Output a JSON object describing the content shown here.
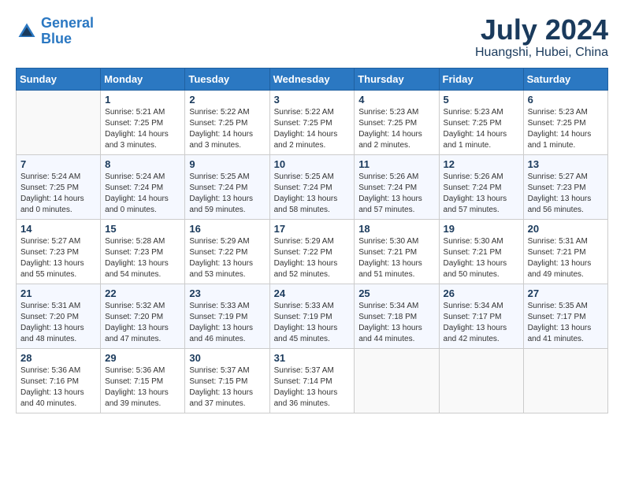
{
  "header": {
    "logo_line1": "General",
    "logo_line2": "Blue",
    "month": "July 2024",
    "location": "Huangshi, Hubei, China"
  },
  "weekdays": [
    "Sunday",
    "Monday",
    "Tuesday",
    "Wednesday",
    "Thursday",
    "Friday",
    "Saturday"
  ],
  "weeks": [
    [
      {
        "day": "",
        "info": ""
      },
      {
        "day": "1",
        "info": "Sunrise: 5:21 AM\nSunset: 7:25 PM\nDaylight: 14 hours\nand 3 minutes."
      },
      {
        "day": "2",
        "info": "Sunrise: 5:22 AM\nSunset: 7:25 PM\nDaylight: 14 hours\nand 3 minutes."
      },
      {
        "day": "3",
        "info": "Sunrise: 5:22 AM\nSunset: 7:25 PM\nDaylight: 14 hours\nand 2 minutes."
      },
      {
        "day": "4",
        "info": "Sunrise: 5:23 AM\nSunset: 7:25 PM\nDaylight: 14 hours\nand 2 minutes."
      },
      {
        "day": "5",
        "info": "Sunrise: 5:23 AM\nSunset: 7:25 PM\nDaylight: 14 hours\nand 1 minute."
      },
      {
        "day": "6",
        "info": "Sunrise: 5:23 AM\nSunset: 7:25 PM\nDaylight: 14 hours\nand 1 minute."
      }
    ],
    [
      {
        "day": "7",
        "info": "Sunrise: 5:24 AM\nSunset: 7:25 PM\nDaylight: 14 hours\nand 0 minutes."
      },
      {
        "day": "8",
        "info": "Sunrise: 5:24 AM\nSunset: 7:24 PM\nDaylight: 14 hours\nand 0 minutes."
      },
      {
        "day": "9",
        "info": "Sunrise: 5:25 AM\nSunset: 7:24 PM\nDaylight: 13 hours\nand 59 minutes."
      },
      {
        "day": "10",
        "info": "Sunrise: 5:25 AM\nSunset: 7:24 PM\nDaylight: 13 hours\nand 58 minutes."
      },
      {
        "day": "11",
        "info": "Sunrise: 5:26 AM\nSunset: 7:24 PM\nDaylight: 13 hours\nand 57 minutes."
      },
      {
        "day": "12",
        "info": "Sunrise: 5:26 AM\nSunset: 7:24 PM\nDaylight: 13 hours\nand 57 minutes."
      },
      {
        "day": "13",
        "info": "Sunrise: 5:27 AM\nSunset: 7:23 PM\nDaylight: 13 hours\nand 56 minutes."
      }
    ],
    [
      {
        "day": "14",
        "info": "Sunrise: 5:27 AM\nSunset: 7:23 PM\nDaylight: 13 hours\nand 55 minutes."
      },
      {
        "day": "15",
        "info": "Sunrise: 5:28 AM\nSunset: 7:23 PM\nDaylight: 13 hours\nand 54 minutes."
      },
      {
        "day": "16",
        "info": "Sunrise: 5:29 AM\nSunset: 7:22 PM\nDaylight: 13 hours\nand 53 minutes."
      },
      {
        "day": "17",
        "info": "Sunrise: 5:29 AM\nSunset: 7:22 PM\nDaylight: 13 hours\nand 52 minutes."
      },
      {
        "day": "18",
        "info": "Sunrise: 5:30 AM\nSunset: 7:21 PM\nDaylight: 13 hours\nand 51 minutes."
      },
      {
        "day": "19",
        "info": "Sunrise: 5:30 AM\nSunset: 7:21 PM\nDaylight: 13 hours\nand 50 minutes."
      },
      {
        "day": "20",
        "info": "Sunrise: 5:31 AM\nSunset: 7:21 PM\nDaylight: 13 hours\nand 49 minutes."
      }
    ],
    [
      {
        "day": "21",
        "info": "Sunrise: 5:31 AM\nSunset: 7:20 PM\nDaylight: 13 hours\nand 48 minutes."
      },
      {
        "day": "22",
        "info": "Sunrise: 5:32 AM\nSunset: 7:20 PM\nDaylight: 13 hours\nand 47 minutes."
      },
      {
        "day": "23",
        "info": "Sunrise: 5:33 AM\nSunset: 7:19 PM\nDaylight: 13 hours\nand 46 minutes."
      },
      {
        "day": "24",
        "info": "Sunrise: 5:33 AM\nSunset: 7:19 PM\nDaylight: 13 hours\nand 45 minutes."
      },
      {
        "day": "25",
        "info": "Sunrise: 5:34 AM\nSunset: 7:18 PM\nDaylight: 13 hours\nand 44 minutes."
      },
      {
        "day": "26",
        "info": "Sunrise: 5:34 AM\nSunset: 7:17 PM\nDaylight: 13 hours\nand 42 minutes."
      },
      {
        "day": "27",
        "info": "Sunrise: 5:35 AM\nSunset: 7:17 PM\nDaylight: 13 hours\nand 41 minutes."
      }
    ],
    [
      {
        "day": "28",
        "info": "Sunrise: 5:36 AM\nSunset: 7:16 PM\nDaylight: 13 hours\nand 40 minutes."
      },
      {
        "day": "29",
        "info": "Sunrise: 5:36 AM\nSunset: 7:15 PM\nDaylight: 13 hours\nand 39 minutes."
      },
      {
        "day": "30",
        "info": "Sunrise: 5:37 AM\nSunset: 7:15 PM\nDaylight: 13 hours\nand 37 minutes."
      },
      {
        "day": "31",
        "info": "Sunrise: 5:37 AM\nSunset: 7:14 PM\nDaylight: 13 hours\nand 36 minutes."
      },
      {
        "day": "",
        "info": ""
      },
      {
        "day": "",
        "info": ""
      },
      {
        "day": "",
        "info": ""
      }
    ]
  ]
}
